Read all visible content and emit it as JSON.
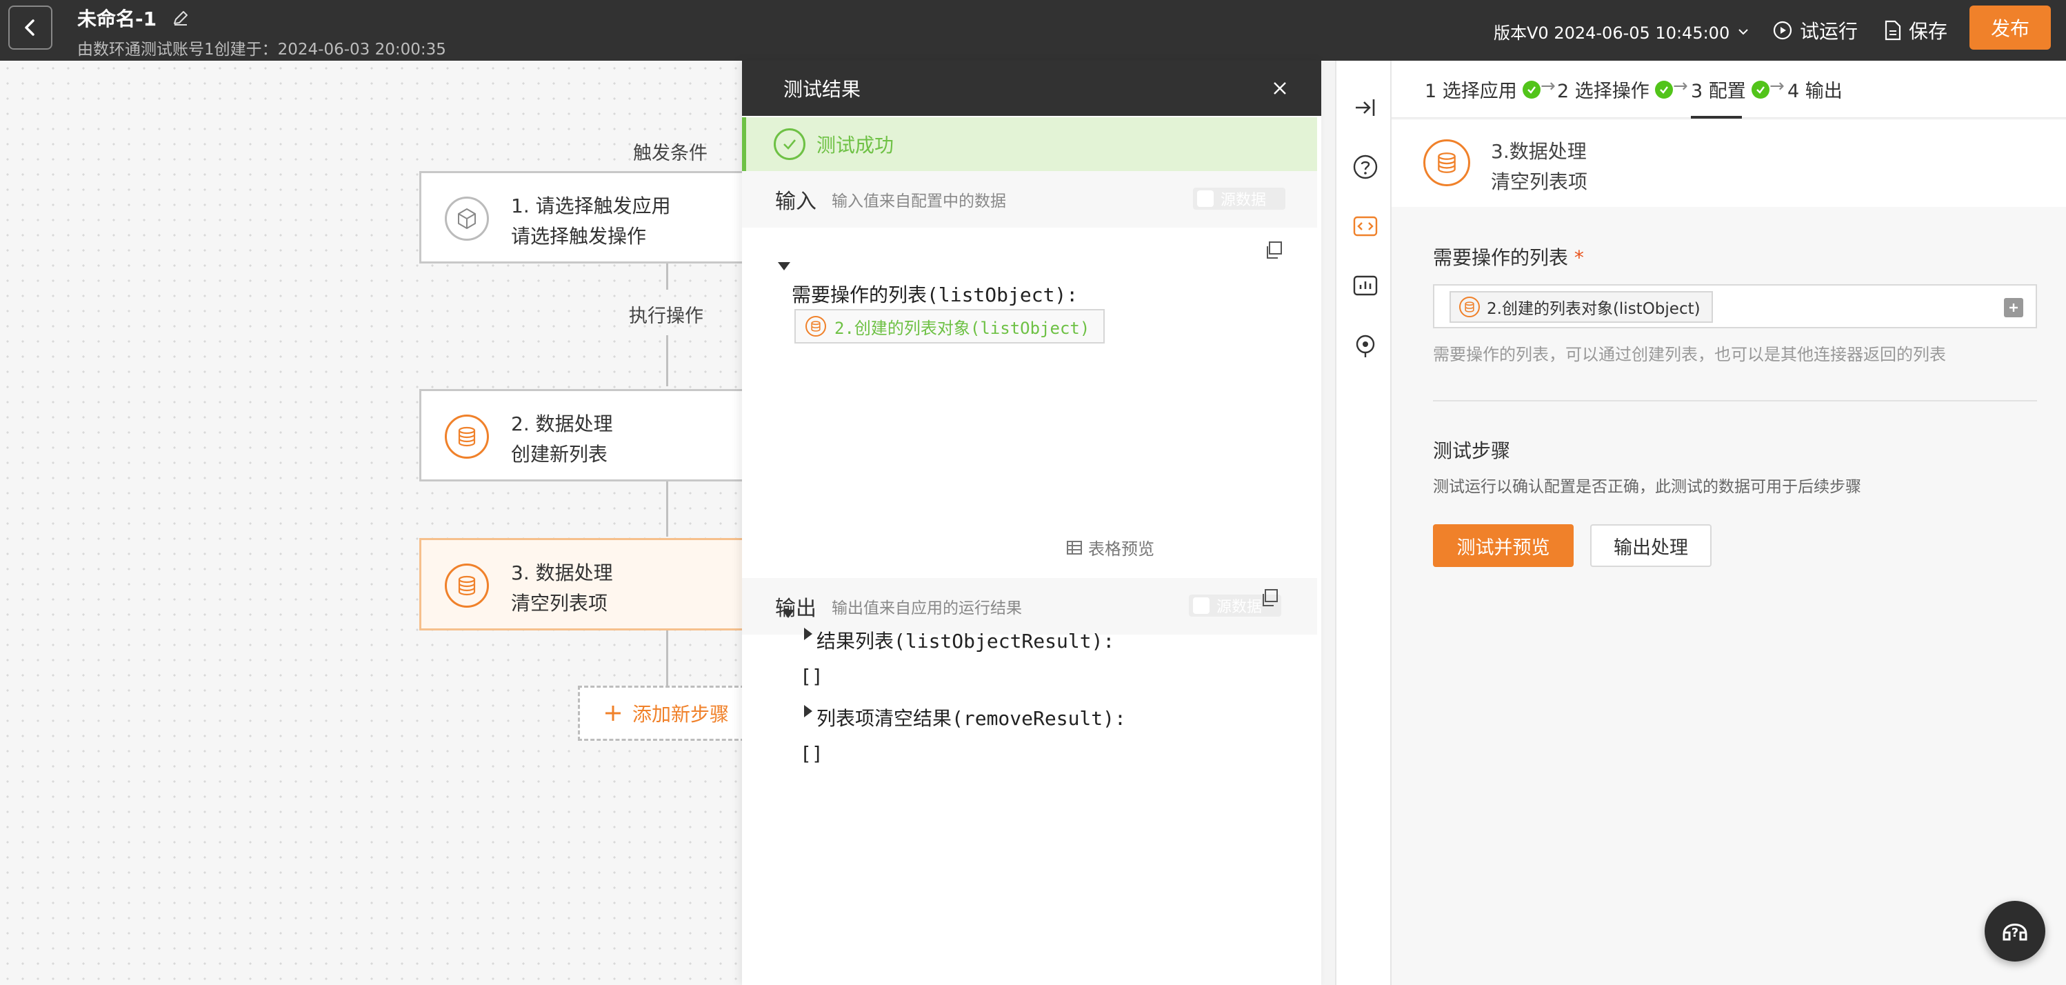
{
  "header": {
    "title": "未命名-1",
    "subtitle": "由数环通测试账号1创建于：2024-06-03 20:00:35",
    "version": "版本V0 2024-06-05 10:45:00",
    "test_run_label": "试运行",
    "save_label": "保存",
    "publish_label": "发布"
  },
  "flow": {
    "trigger_label": "触发条件",
    "action_label": "执行操作",
    "nodes": [
      {
        "line1": "1. 请选择触发应用",
        "line2": "请选择触发操作"
      },
      {
        "line1": "2. 数据处理",
        "line2": "创建新列表"
      },
      {
        "line1": "3. 数据处理",
        "line2": "清空列表项"
      }
    ],
    "add_step_label": "添加新步骤"
  },
  "test_panel": {
    "title": "测试结果",
    "status": "测试成功",
    "input": {
      "title": "输入",
      "subtitle": "输入值来自配置中的数据",
      "toggle_label": "源数据",
      "field_key": "需要操作的列表(listObject):",
      "field_ref": "2.创建的列表对象(listObject)"
    },
    "output": {
      "title": "输出",
      "subtitle": "输出值来自应用的运行结果",
      "table_preview": "表格预览",
      "toggle_label": "源数据",
      "items": [
        {
          "key": "结果列表(listObjectResult):",
          "value": "[]"
        },
        {
          "key": "列表项清空结果(removeResult):",
          "value": "[]"
        }
      ]
    }
  },
  "config": {
    "steps": [
      {
        "label": "1 选择应用",
        "done": true
      },
      {
        "label": "2 选择操作",
        "done": true
      },
      {
        "label": "3 配置",
        "done": true
      },
      {
        "label": "4 输出",
        "done": false
      }
    ],
    "header_line1": "3.数据处理",
    "header_line2": "清空列表项",
    "field_label": "需要操作的列表",
    "required_mark": "*",
    "field_chip": "2.创建的列表对象(listObject)",
    "field_hint": "需要操作的列表，可以通过创建列表，也可以是其他连接器返回的列表",
    "test_title": "测试步骤",
    "test_desc": "测试运行以确认配置是否正确，此测试的数据可用于后续步骤",
    "primary_btn": "测试并预览",
    "secondary_btn": "输出处理"
  },
  "colors": {
    "accent": "#f0812a",
    "success": "#6ec145",
    "header_bg": "#323232"
  }
}
